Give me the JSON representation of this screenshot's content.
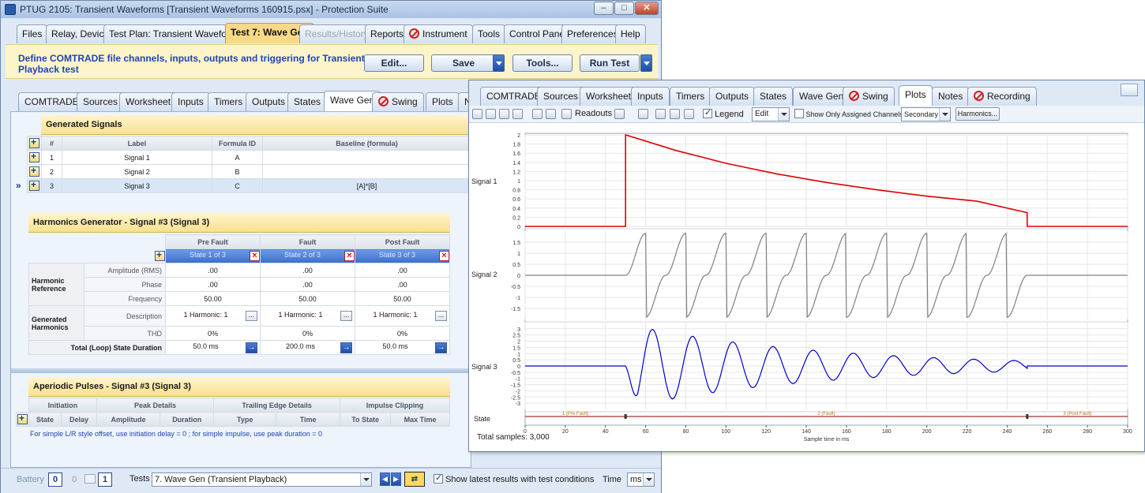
{
  "window": {
    "title": "PTUG 2105: Transient Waveforms [Transient Waveforms 160915.psx] - Protection Suite",
    "min_label": "–",
    "max_label": "□",
    "close_label": "✕"
  },
  "top_tabs": [
    "Files",
    "Relay, Device",
    "Test Plan: Transient Waveforms",
    "Test 7:  Wave Gen",
    "Results/History",
    "Reports",
    "Instrument",
    "Tools",
    "Control Panel",
    "Preferences",
    "Help"
  ],
  "banner": {
    "text": "Define COMTRADE file channels, inputs, outputs and triggering for Transient Playback test",
    "edit": "Edit...",
    "save": "Save",
    "tools": "Tools...",
    "run": "Run Test"
  },
  "sub_tabs": [
    "COMTRADE",
    "Sources",
    "Worksheet",
    "Inputs",
    "Timers",
    "Outputs",
    "States",
    "Wave Gen",
    "Swing",
    "Plots",
    "N"
  ],
  "generated_signals": {
    "title": "Generated Signals",
    "headers": [
      "#",
      "Label",
      "Formula ID",
      "Baseline (formula)"
    ],
    "rows": [
      {
        "num": "1",
        "label": "Signal 1",
        "formula": "A",
        "baseline": ""
      },
      {
        "num": "2",
        "label": "Signal 2",
        "formula": "B",
        "baseline": ""
      },
      {
        "num": "3",
        "label": "Signal 3",
        "formula": "C",
        "baseline": "[A]*[B]"
      }
    ],
    "current_marker": "»"
  },
  "harmonics": {
    "title": "Harmonics Generator - Signal #3 (Signal 3)",
    "columns": [
      "Pre Fault",
      "Fault",
      "Post Fault"
    ],
    "states": [
      "State 1 of 3",
      "State 2 of 3",
      "State 3 of 3"
    ],
    "group1": "Harmonic Reference",
    "group2": "Generated Harmonics",
    "row_labels": [
      "Amplitude (RMS)",
      "Phase",
      "Frequency",
      "Description",
      "THD"
    ],
    "amplitude": [
      ".00",
      ".00",
      ".00"
    ],
    "phase": [
      ".00",
      ".00",
      ".00"
    ],
    "frequency": [
      "50.00",
      "50.00",
      "50.00"
    ],
    "description": [
      "1 Harmonic: 1",
      "1 Harmonic: 1",
      "1 Harmonic: 1"
    ],
    "thd": [
      "0%",
      "0%",
      "0%"
    ],
    "duration_label": "Total (Loop) State Duration",
    "duration": [
      "50.0 ms",
      "200.0 ms",
      "50.0 ms"
    ]
  },
  "pulses": {
    "title": "Aperiodic Pulses - Signal #3 (Signal 3)",
    "groups": [
      "Initiation",
      "Peak Details",
      "Trailing Edge Details",
      "Impulse Clipping"
    ],
    "headers": [
      "State",
      "Delay",
      "Amplitude",
      "Duration",
      "Type",
      "Time",
      "To State",
      "Max Time"
    ],
    "note": "For simple L/R style offset, use initiation delay = 0 ; for simple impulse, use peak duration = 0"
  },
  "statusbar": {
    "battery": "Battery",
    "battery_value": "0",
    "count_a": "0",
    "count_b": "1",
    "tests_label": "Tests",
    "tests_value": "7. Wave Gen (Transient Playback)",
    "show_latest": "Show latest results with test conditions",
    "show_latest_checked": true,
    "time_label": "Time",
    "time_unit": "ms"
  },
  "plots": {
    "tabs": [
      "COMTRADE",
      "Sources",
      "Worksheet",
      "Inputs",
      "Timers",
      "Outputs",
      "States",
      "Wave Gen",
      "Swing",
      "Plots",
      "Notes",
      "Recording"
    ],
    "toolbar": {
      "readouts": "Readouts",
      "legend": "Legend",
      "legend_checked": true,
      "edit": "Edit",
      "show_assigned": "Show Only Assigned Channels",
      "show_assigned_checked": false,
      "secondary": "Secondary",
      "harmonics": "Harmonics..."
    },
    "signal_labels": [
      "Signal 1",
      "Signal 2",
      "Signal 3",
      "State"
    ],
    "total_samples": "Total samples: 3,000",
    "xlabel": "Sample time in ms",
    "state_labels": [
      "1 (Pre Fault)",
      "2 (Fault)",
      "3 (Post Fault)"
    ]
  },
  "chart_data": [
    {
      "type": "line",
      "series": [
        {
          "name": "Signal 1",
          "color": "#e00000"
        }
      ],
      "x": [
        0,
        50,
        50,
        75,
        100,
        125,
        150,
        175,
        200,
        225,
        250,
        250,
        300
      ],
      "values": [
        0,
        0,
        2.0,
        1.66,
        1.38,
        1.15,
        0.96,
        0.8,
        0.66,
        0.55,
        0.3,
        0,
        0
      ],
      "ylim": [
        0,
        2
      ],
      "yticks": [
        "0",
        "0.2",
        "0.4",
        "0.6",
        "0.8",
        "1",
        "1.2",
        "1.4",
        "1.6",
        "1.8",
        "2"
      ]
    },
    {
      "type": "line",
      "series": [
        {
          "name": "Signal 2",
          "color": "#808080"
        }
      ],
      "description_values": {
        "amplitude": 1.9,
        "period_ms": 20,
        "start_ms": 50,
        "end_ms": 250
      },
      "ylim": [
        -2,
        2
      ],
      "yticks": [
        "-1.5",
        "-1",
        "-0.5",
        "0",
        "0.5",
        "1",
        "1.5"
      ]
    },
    {
      "type": "line",
      "series": [
        {
          "name": "Signal 3",
          "color": "#0000cc"
        }
      ],
      "description_values": {
        "peak_amplitude": 3.4,
        "period_ms": 20,
        "start_ms": 50,
        "end_ms": 250
      },
      "ylim": [
        -3.5,
        3.5
      ],
      "yticks": [
        "-3",
        "-2.5",
        "-2",
        "-1.5",
        "-1",
        "-0.5",
        "0",
        "0.5",
        "1",
        "1.5",
        "2",
        "2.5",
        "3"
      ]
    }
  ],
  "x_axis": {
    "ticks": [
      "0",
      "20",
      "40",
      "60",
      "80",
      "100",
      "120",
      "140",
      "160",
      "180",
      "200",
      "220",
      "240",
      "260",
      "280",
      "300"
    ],
    "xlim": [
      0,
      300
    ]
  }
}
